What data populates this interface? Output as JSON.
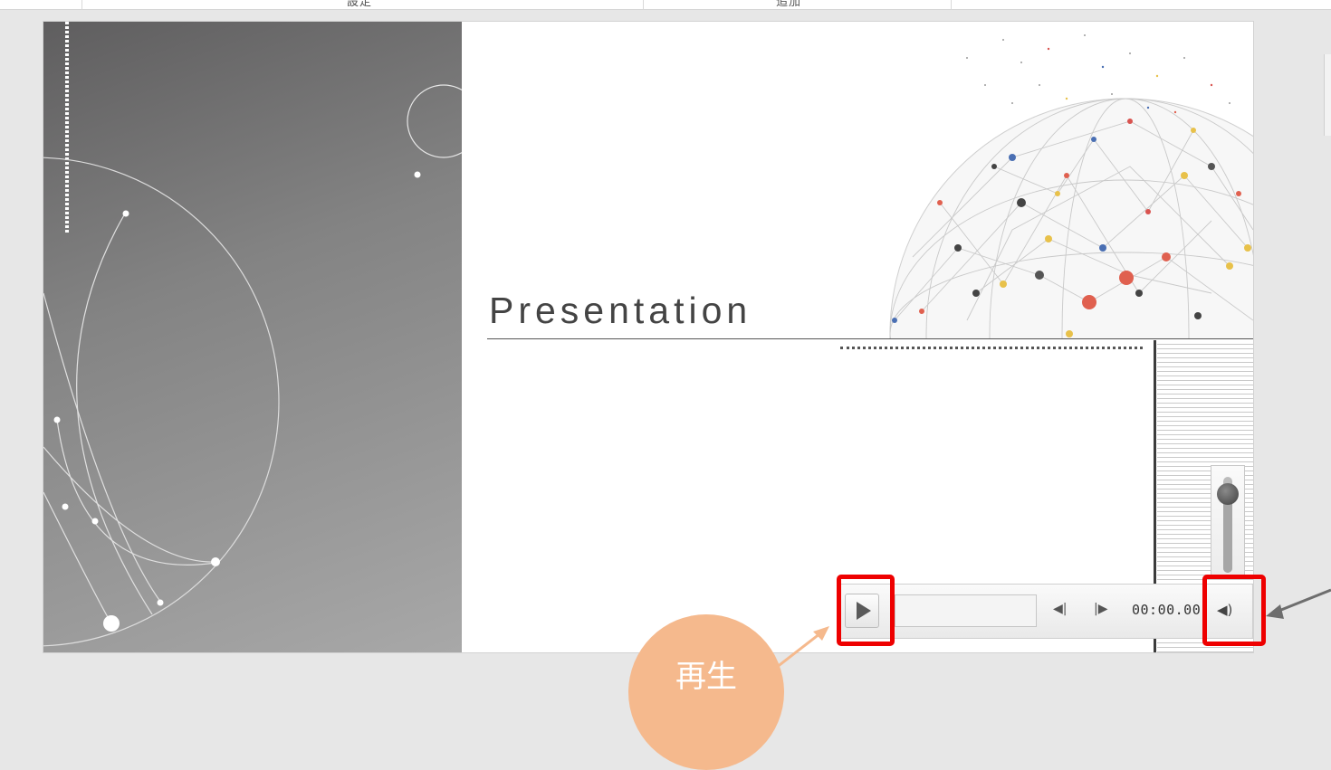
{
  "top_tabs": [
    "設定",
    "追加"
  ],
  "slide": {
    "title": "Presentation"
  },
  "media": {
    "time": "00:00.00",
    "play_icon": "play-icon",
    "prev_icon": "step-back-icon",
    "next_icon": "step-forward-icon",
    "volume_icon": "volume-icon",
    "volume_level": 0.85
  },
  "annotation": {
    "callout_text": "再生",
    "highlight_color": "#ee0000",
    "callout_color": "#f5b98d",
    "arrow_color_play": "#f5b98d",
    "arrow_color_volume": "#6e6e6e"
  }
}
